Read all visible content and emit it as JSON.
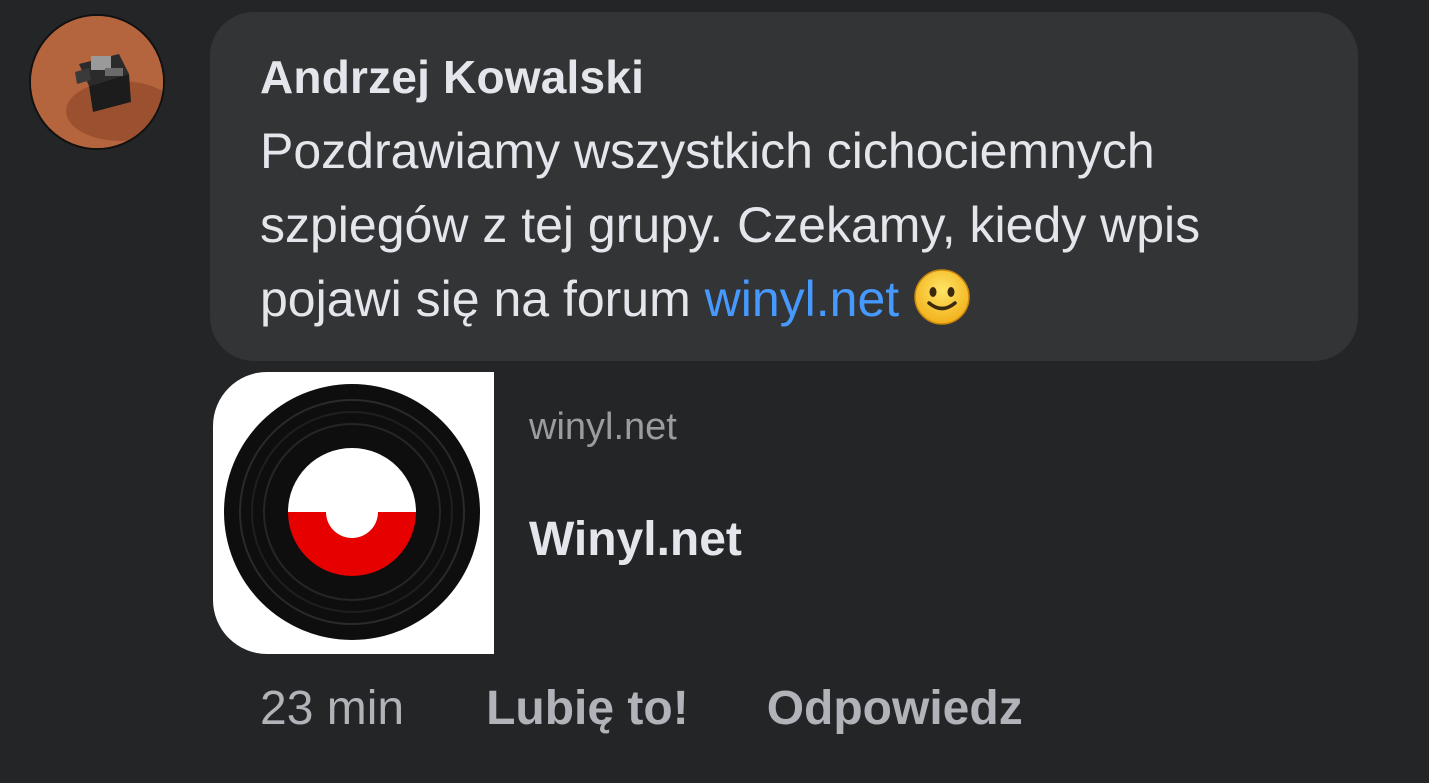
{
  "comment": {
    "author": "Andrzej Kowalski",
    "text_before_link": "Pozdrawiamy wszystkich cichociemnych szpiegów z tej grupy. Czekamy, kiedy wpis pojawi się na forum ",
    "link_text": "winyl.net",
    "emoji": "slightly-smiling-face-icon"
  },
  "link_preview": {
    "domain": "winyl.net",
    "title": "Winyl.net",
    "thumbnail": "vinyl-record-icon"
  },
  "actions": {
    "time": "23 min",
    "like_label": "Lubię to!",
    "reply_label": "Odpowiedz"
  },
  "colors": {
    "background": "#242527",
    "bubble": "#333436",
    "text": "#e4e6eb",
    "link": "#4599ff",
    "muted": "#b0b3b8"
  }
}
